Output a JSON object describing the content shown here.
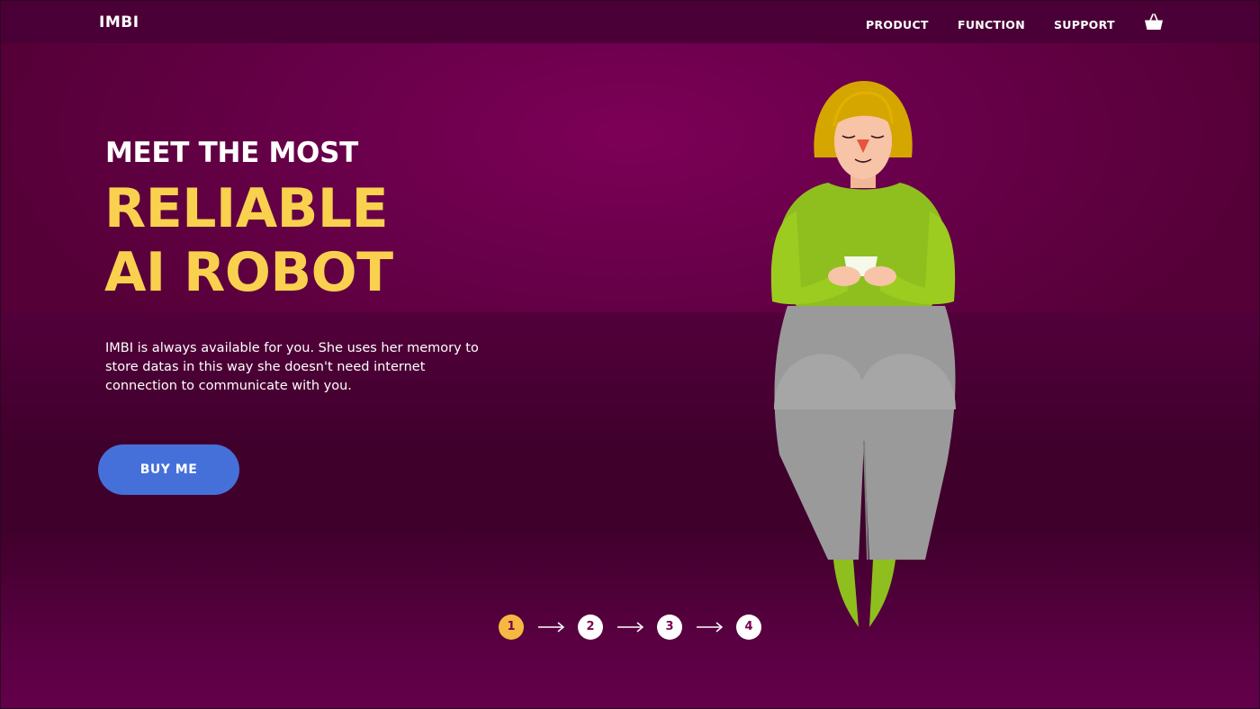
{
  "brand": {
    "logo": "IMBI"
  },
  "nav": {
    "links": [
      "PRODUCT",
      "FUNCTION",
      "SUPPORT"
    ],
    "cart_icon": "basket-icon"
  },
  "hero": {
    "eyebrow": "MEET THE MOST",
    "headline_line1": "RELIABLE",
    "headline_line2": "AI ROBOT",
    "description": "IMBI is always available for you. She uses her memory to store datas in this way she doesn't need internet connection to communicate with you.",
    "cta_label": "BUY ME"
  },
  "stepper": {
    "steps": [
      "1",
      "2",
      "3",
      "4"
    ],
    "active_step": 1
  },
  "colors": {
    "accent_yellow": "#f9d14e",
    "button_blue": "#4670d9",
    "active_step": "#f5b942",
    "background_purple": "#6a004b"
  }
}
